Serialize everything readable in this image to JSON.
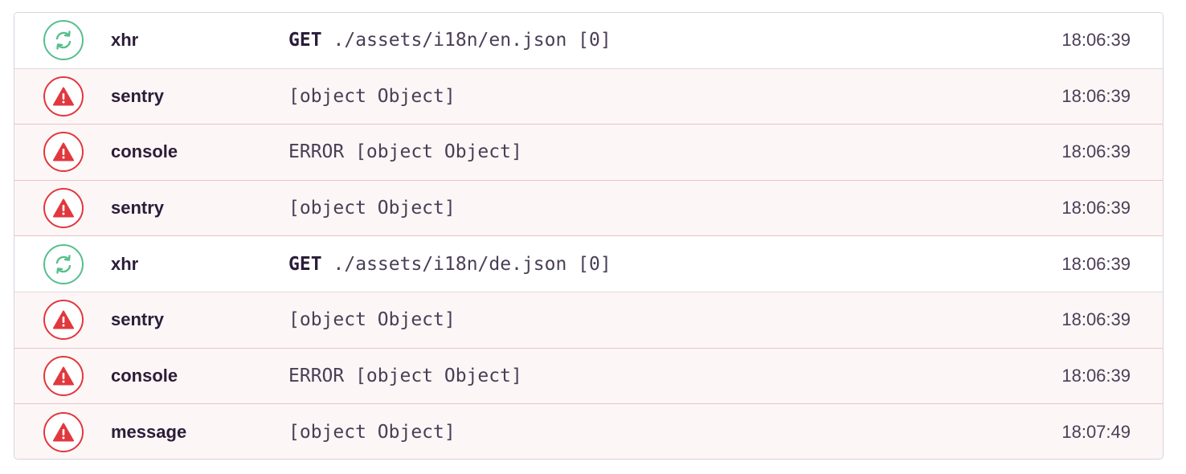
{
  "colors": {
    "error": "#e0383e",
    "default": "#57be8c",
    "error_row_bg": "#fdf6f6",
    "error_row_border": "#e8c4c6"
  },
  "breadcrumbs": [
    {
      "type": "default",
      "icon": "refresh-icon",
      "category": "xhr",
      "method": "GET",
      "message": "./assets/i18n/en.json [0]",
      "time": "18:06:39"
    },
    {
      "type": "error",
      "icon": "warning-icon",
      "category": "sentry",
      "method": "",
      "message": "[object Object]",
      "time": "18:06:39"
    },
    {
      "type": "error",
      "icon": "warning-icon",
      "category": "console",
      "method": "",
      "message": "ERROR [object Object]",
      "time": "18:06:39"
    },
    {
      "type": "error",
      "icon": "warning-icon",
      "category": "sentry",
      "method": "",
      "message": "[object Object]",
      "time": "18:06:39"
    },
    {
      "type": "default",
      "icon": "refresh-icon",
      "category": "xhr",
      "method": "GET",
      "message": "./assets/i18n/de.json [0]",
      "time": "18:06:39"
    },
    {
      "type": "error",
      "icon": "warning-icon",
      "category": "sentry",
      "method": "",
      "message": "[object Object]",
      "time": "18:06:39"
    },
    {
      "type": "error",
      "icon": "warning-icon",
      "category": "console",
      "method": "",
      "message": "ERROR [object Object]",
      "time": "18:06:39"
    },
    {
      "type": "error",
      "icon": "warning-icon",
      "category": "message",
      "method": "",
      "message": "[object Object]",
      "time": "18:07:49"
    }
  ]
}
